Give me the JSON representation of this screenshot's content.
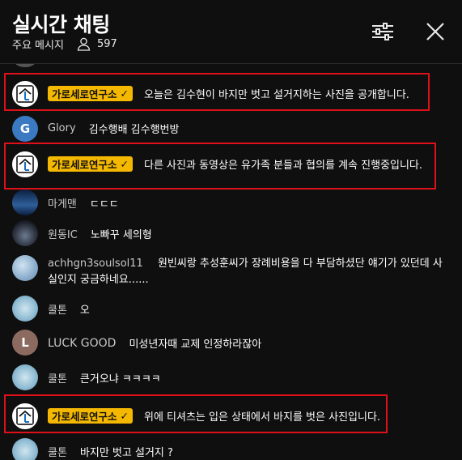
{
  "header": {
    "title": "실시간 채팅",
    "mode": "주요 메시지",
    "viewers": "597",
    "icons": [
      "viewer-icon",
      "filter-sliders-icon",
      "close-icon"
    ]
  },
  "messages": [
    {
      "author": "가로세로연구소",
      "owner": true,
      "text": "오늘은 김수현이 바지만 벗고 설거지하는 사진을 공개합니다."
    },
    {
      "author": "Glory",
      "avatar_letter": "G",
      "avatar_color": "#3b79c2",
      "text": "김수행배 김수행번방"
    },
    {
      "author": "가로세로연구소",
      "owner": true,
      "text": "다른 사진과 동영상은 유가족 분들과 협의를 계속 진행중입니다."
    },
    {
      "author": "마게맨",
      "text": "ㄷㄷㄷ"
    },
    {
      "author": "원동IC",
      "text": "노빠꾸 세의형"
    },
    {
      "author": "achhgn3soulsol11",
      "text": "원빈씨랑 추성훈씨가 장례비용을 다 부담하셨단 얘기가 있던데 사실인지 궁금하네요......"
    },
    {
      "author": "쿨톤",
      "text": "오"
    },
    {
      "author": "LUCK GOOD",
      "avatar_letter": "L",
      "avatar_color": "#8c6a5f",
      "text": "미성년자때 교제 인정하라잖아"
    },
    {
      "author": "쿨톤",
      "text": "큰거오냐 ㅋㅋㅋㅋ"
    },
    {
      "author": "가로세로연구소",
      "owner": true,
      "text": "위에 티셔츠는 입은 상태에서 바지를 벗은 사진입니다."
    },
    {
      "author": "쿨톤",
      "text": "바지만 벗고 설거지 ?"
    }
  ],
  "colors": {
    "highlight": "#e0101b",
    "badge": "#f5b800",
    "background": "#0f0f0f"
  }
}
